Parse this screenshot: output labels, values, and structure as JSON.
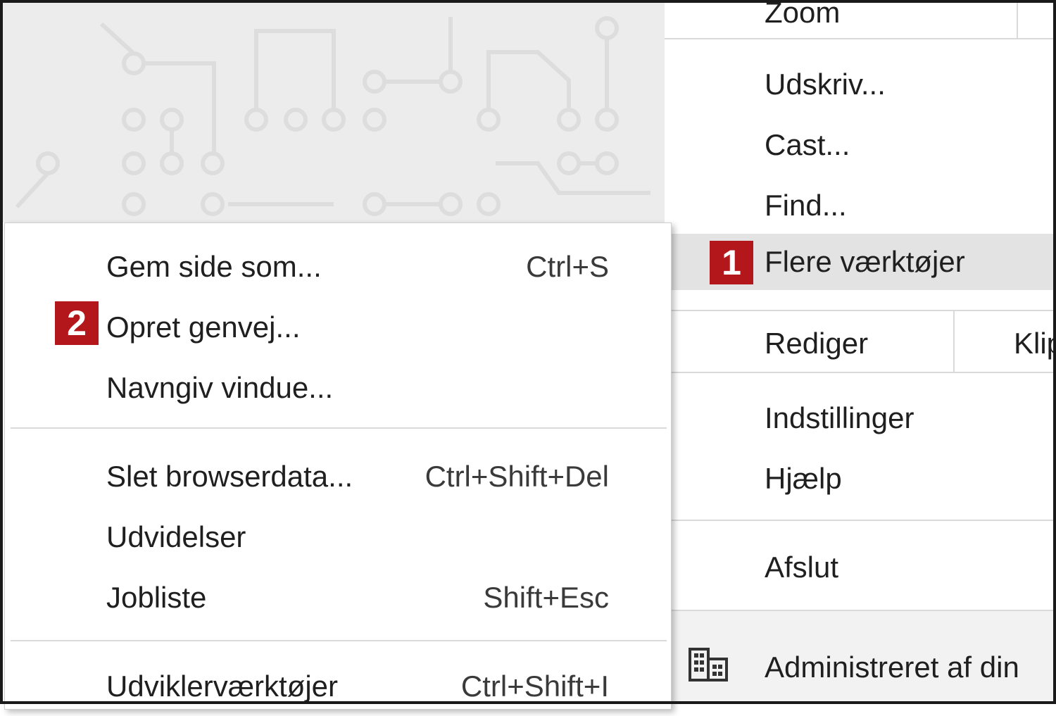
{
  "main_menu": {
    "items": [
      {
        "label": "Zoom"
      },
      {
        "label": "Udskriv..."
      },
      {
        "label": "Cast..."
      },
      {
        "label": "Find..."
      },
      {
        "label": "Flere værktøjer",
        "badge": "1"
      },
      {
        "label": "Rediger",
        "edit_cut": "Klip"
      },
      {
        "label": "Indstillinger"
      },
      {
        "label": "Hjælp"
      },
      {
        "label": "Afslut"
      },
      {
        "label": "Administreret af din ",
        "icon": "building-icon"
      }
    ]
  },
  "submenu": {
    "badge": "2",
    "items": [
      {
        "label": "Gem side som...",
        "shortcut": "Ctrl+S"
      },
      {
        "label": "Opret genvej...",
        "shortcut": ""
      },
      {
        "label": "Navngiv vindue...",
        "shortcut": ""
      },
      {
        "label": "Slet browserdata...",
        "shortcut": "Ctrl+Shift+Del"
      },
      {
        "label": "Udvidelser",
        "shortcut": ""
      },
      {
        "label": "Jobliste",
        "shortcut": "Shift+Esc"
      },
      {
        "label": "Udviklerværktøjer",
        "shortcut": "Ctrl+Shift+I"
      }
    ]
  },
  "colors": {
    "badge": "#b3171b",
    "hover": "#e3e3e3",
    "separator": "#dadada"
  }
}
